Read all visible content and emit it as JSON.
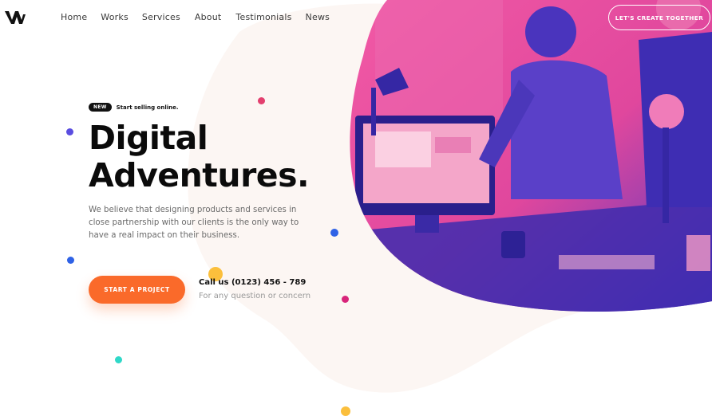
{
  "brand": {
    "logo_icon": "w-logo-icon"
  },
  "nav": {
    "items": [
      "Home",
      "Works",
      "Services",
      "About",
      "Testimonials",
      "News"
    ]
  },
  "header_cta": {
    "label": "LET'S CREATE TOGETHER"
  },
  "hero": {
    "badge": "NEW",
    "tagline": "Start selling online.",
    "title_line1": "Digital",
    "title_line2": "Adventures.",
    "description": "We believe that designing products and services in close partnership with our clients is the only way to have a real impact on their business.",
    "primary_button": "START A PROJECT",
    "call_label": "Call us (0123) 456 - 789",
    "call_sub": "For any question or concern"
  },
  "colors": {
    "accent": "#fa6a2a",
    "photo_pink": "#f0559f",
    "photo_purple": "#3f2fb8",
    "blob": "#fcf7f5"
  }
}
